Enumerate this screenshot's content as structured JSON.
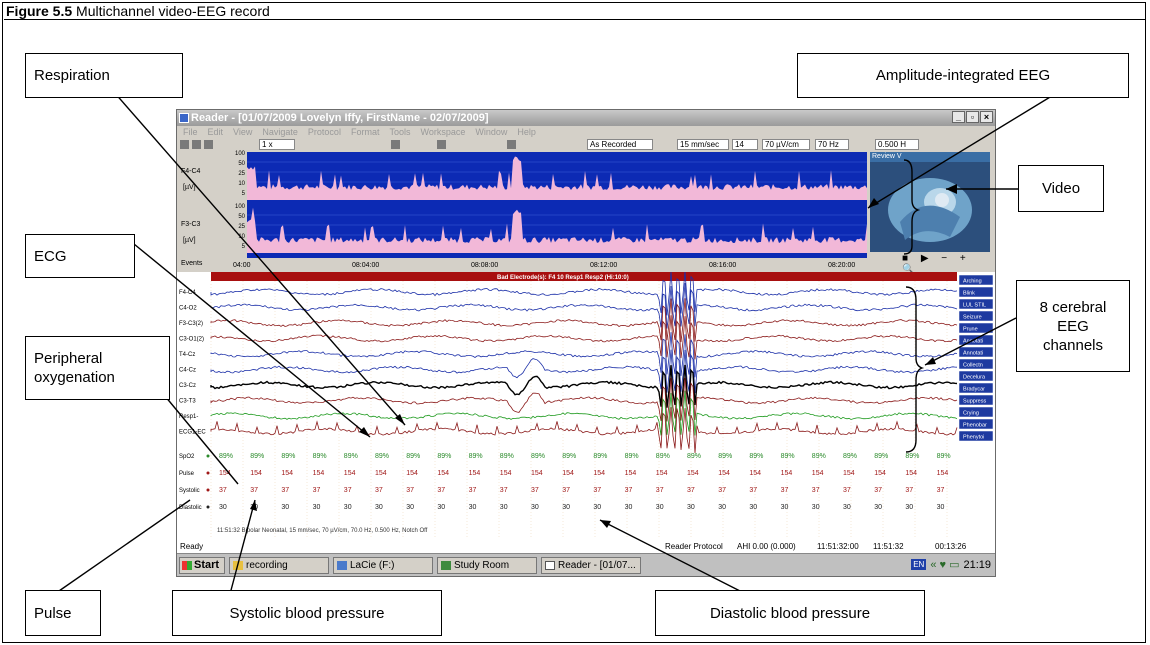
{
  "figure": {
    "label": "Figure 5.5",
    "caption": "Multichannel video-EEG record"
  },
  "window": {
    "title": "Reader - [01/07/2009 Lovelyn Iffy, FirstName - 02/07/2009]",
    "menu": [
      "File",
      "Edit",
      "View",
      "Navigate",
      "Protocol",
      "Format",
      "Tools",
      "Workspace",
      "Window",
      "Help"
    ],
    "toolbar": {
      "speed": "1 x",
      "montage": "As Recorded",
      "timebase": "15 mm/sec",
      "channels": "14",
      "sensitivity": "70 µV/cm",
      "hf_filter": "70 Hz",
      "lf_filter": "0.500 H"
    }
  },
  "aeeg": {
    "channels": [
      {
        "name": "F4-C4",
        "unit": "[µV]",
        "scale": [
          "100",
          "50",
          "25",
          "10",
          "5"
        ]
      },
      {
        "name": "F3-C3",
        "unit": "[µV]",
        "scale": [
          "100",
          "50",
          "25",
          "10",
          "5"
        ]
      }
    ],
    "events_label": "Events",
    "time_ticks": [
      "04:00",
      "08:04:00",
      "08:08:00",
      "08:12:00",
      "08:16:00",
      "08:20:00"
    ]
  },
  "video_panel": {
    "title": "Review V",
    "controls": "■ ▶ − + 🔍"
  },
  "eeg": {
    "banner": "Bad Electrode(s): F4 10 Resp1 Resp2 (Hi:10:0)",
    "channels": [
      "F4-C4",
      "C4-O2",
      "F3-C3(2)",
      "C3-O1(2)",
      "T4-Cz",
      "C4-Cz",
      "C3-Cz",
      "C3-T3",
      "Resp1-",
      "ECG1-EC"
    ],
    "channel_colors": [
      "#1b2fa8",
      "#1b2fa8",
      "#8b1a1a",
      "#8b1a1a",
      "#1b2fa8",
      "#1b2fa8",
      "#000000",
      "#8b1a1a",
      "#1e9a1e",
      "#8b1a1a"
    ],
    "event_tags": [
      "Arching",
      "Blink",
      "LUL STIL",
      "Seizure",
      "Prune",
      "Annotati",
      "Annotati",
      "Collectn",
      "Decelura",
      "Bradycar",
      "Suppress",
      "Crying",
      "Phenobar",
      "Phenytoi"
    ],
    "vitals": [
      {
        "name": "SpO2",
        "value": "89%",
        "color": "#2a8a2a"
      },
      {
        "name": "Pulse",
        "value": "154",
        "color": "#a01818"
      },
      {
        "name": "Systolic",
        "value": "37",
        "color": "#a01818"
      },
      {
        "name": "Diastolic",
        "value": "30",
        "color": "#222222"
      }
    ],
    "vitals_columns": 24,
    "footer_info": "11:51:32 Bipolar Neonatal, 15 mm/sec, 70 µV/cm, 70.0 Hz, 0.500 Hz, Notch Off"
  },
  "statusbar": {
    "ready": "Ready",
    "protocol": "Reader Protocol",
    "ahi": "AHI 0.00 (0.000)",
    "time1": "11:51:32:00",
    "time2": "11:51:32",
    "elapsed": "00:13:26"
  },
  "taskbar": {
    "start": "Start",
    "items": [
      "recording",
      "LaCie (F:)",
      "Study Room",
      "Reader - [01/07..."
    ],
    "lang": "EN",
    "clock": "21:19"
  },
  "callouts": {
    "respiration": "Respiration",
    "aeeg": "Amplitude-integrated EEG",
    "video": "Video",
    "ecg": "ECG",
    "cerebral": "8 cerebral EEG channels",
    "oxygenation": "Peripheral oxygenation",
    "pulse": "Pulse",
    "systolic": "Systolic blood pressure",
    "diastolic": "Diastolic blood pressure"
  },
  "colors": {
    "aeeg_background": "#0c2ab4",
    "aeeg_trace": "#f2b8d8",
    "banner": "#a80f0f",
    "tag": "#1e3aa0"
  }
}
